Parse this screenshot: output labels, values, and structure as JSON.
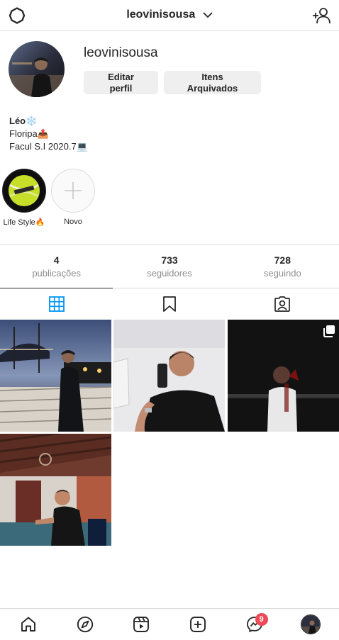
{
  "header": {
    "username": "leovinisousa",
    "icons": {
      "settings": "settings-icon",
      "dropdown": "chevron-down-icon",
      "add_user": "add-user-icon"
    }
  },
  "profile": {
    "username": "leovinisousa",
    "edit_button": "Editar perfil",
    "archive_button": "Itens Arquivados",
    "bio": {
      "name": "Léo❄️",
      "line1": "Floripa📤",
      "line2": "Facul S.I 2020.7💻"
    }
  },
  "highlights": [
    {
      "label": "Life Style🔥",
      "icon": "tennis-ball-image"
    },
    {
      "label": "Novo",
      "icon": "plus-icon"
    }
  ],
  "stats": [
    {
      "value": "4",
      "label": "publicações"
    },
    {
      "value": "733",
      "label": "seguidores"
    },
    {
      "value": "728",
      "label": "seguindo"
    }
  ],
  "tabs": [
    {
      "name": "grid-icon",
      "active": true
    },
    {
      "name": "bookmark-icon",
      "active": false
    },
    {
      "name": "tagged-icon",
      "active": false
    }
  ],
  "posts": [
    {
      "name": "post-bridge-night",
      "multi": false
    },
    {
      "name": "post-selfie-mirror",
      "multi": false
    },
    {
      "name": "post-night-drink",
      "multi": true
    },
    {
      "name": "post-bar-sitting",
      "multi": false
    }
  ],
  "bottom_nav": {
    "items": [
      "home-icon",
      "explore-icon",
      "reels-icon",
      "new-post-icon",
      "messenger-icon",
      "profile-avatar"
    ],
    "messenger_badge": "9"
  },
  "colors": {
    "text": "#262626",
    "secondary_text": "#8e8e8e",
    "divider": "#dbdbdb",
    "button_bg": "#efefef",
    "active_tab": "#0095f6",
    "badge": "#ed4956"
  }
}
